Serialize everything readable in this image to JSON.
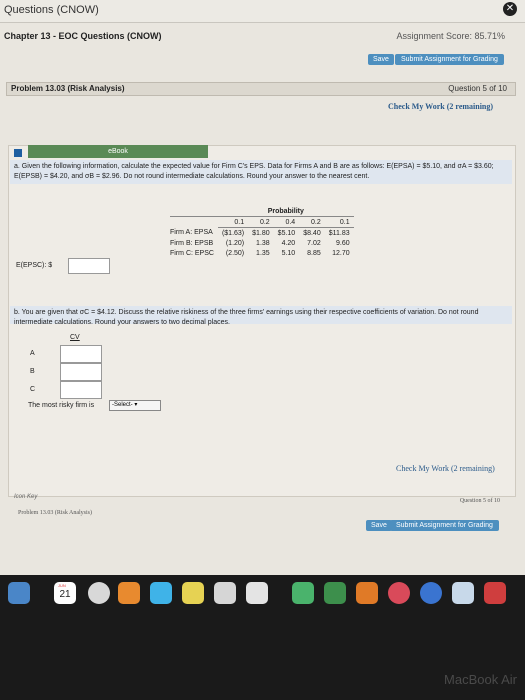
{
  "window": {
    "title": "Questions (CNOW)"
  },
  "chapter": {
    "title": "Chapter 13 - EOC Questions (CNOW)",
    "score": "Assignment Score: 85.71%"
  },
  "toolbar": {
    "save": "Save",
    "submit": "Submit Assignment for Grading"
  },
  "problem": {
    "title": "Problem 13.03 (Risk Analysis)",
    "nav": "Question 5 of 10"
  },
  "check_work": "Check My Work (2 remaining)",
  "ebook": "eBook",
  "part_a": {
    "prompt": "a. Given the following information, calculate the expected value for Firm C's EPS. Data for Firms A and B are as follows: E(EPSA) = $5.10, and σA = $3.60; E(EPSB) = $4.20, and σB = $2.96. Do not round intermediate calculations. Round your answer to the nearest cent.",
    "answer_label": "E(EPSC): $",
    "answer_value": ""
  },
  "table": {
    "header": "Probability",
    "probs": [
      "0.1",
      "0.2",
      "0.4",
      "0.2",
      "0.1"
    ],
    "rows": [
      {
        "label": "Firm A: EPSA",
        "values": [
          "($1.63)",
          "$1.80",
          "$5.10",
          "$8.40",
          "$11.83"
        ]
      },
      {
        "label": "Firm B: EPSB",
        "values": [
          "(1.20)",
          "1.38",
          "4.20",
          "7.02",
          "9.60"
        ]
      },
      {
        "label": "Firm C: EPSC",
        "values": [
          "(2.50)",
          "1.35",
          "5.10",
          "8.85",
          "12.70"
        ]
      }
    ]
  },
  "part_b": {
    "prompt": "b. You are given that σC = $4.12. Discuss the relative riskiness of the three firms' earnings using their respective coefficients of variation. Do not round intermediate calculations. Round your answers to two decimal places.",
    "cv_header": "CV",
    "rows": [
      "A",
      "B",
      "C"
    ],
    "riskiest_label": "The most risky firm is",
    "select_value": "-Select-"
  },
  "icon_key": "Icon Key",
  "footer": {
    "problem": "Problem 13.03 (Risk Analysis)",
    "nav": "Question 5 of 10"
  },
  "dock": {
    "calendar_day": "21",
    "calendar_month": "JUN"
  },
  "laptop": "MacBook Air"
}
